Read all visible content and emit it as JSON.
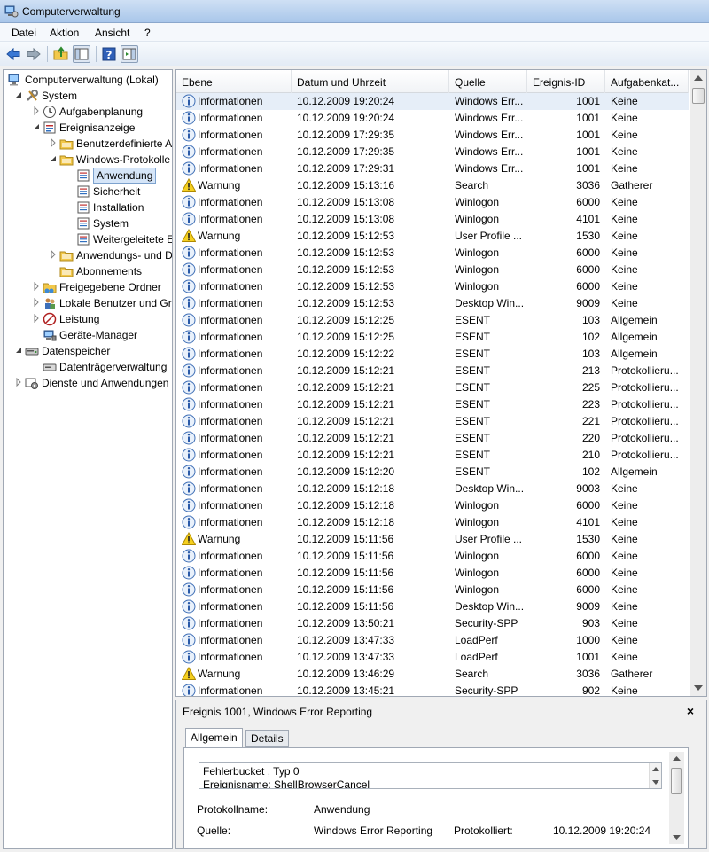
{
  "window": {
    "title": "Computerverwaltung"
  },
  "menu": [
    "Datei",
    "Aktion",
    "Ansicht",
    "?"
  ],
  "toolbar": {
    "buttons": [
      "back-arrow-icon",
      "forward-arrow-icon",
      "up-folder-icon",
      "show-hide-tree-icon",
      "help-icon",
      "action-pane-icon"
    ]
  },
  "tree": [
    {
      "label": "Computerverwaltung (Lokal)",
      "icon": "computer-icon",
      "level": 0,
      "twisty": "none"
    },
    {
      "label": "System",
      "icon": "tools-icon",
      "level": 1,
      "twisty": "expanded"
    },
    {
      "label": "Aufgabenplanung",
      "icon": "clock-icon",
      "level": 2,
      "twisty": "collapsed"
    },
    {
      "label": "Ereignisanzeige",
      "icon": "event-viewer-icon",
      "level": 2,
      "twisty": "expanded"
    },
    {
      "label": "Benutzerdefinierte Ansichten",
      "icon": "folder-icon",
      "level": 3,
      "twisty": "collapsed"
    },
    {
      "label": "Windows-Protokolle",
      "icon": "folder-icon",
      "level": 3,
      "twisty": "expanded"
    },
    {
      "label": "Anwendung",
      "icon": "log-icon",
      "level": 4,
      "twisty": "none",
      "selected": true
    },
    {
      "label": "Sicherheit",
      "icon": "log-icon",
      "level": 4,
      "twisty": "none"
    },
    {
      "label": "Installation",
      "icon": "log-icon",
      "level": 4,
      "twisty": "none"
    },
    {
      "label": "System",
      "icon": "log-icon",
      "level": 4,
      "twisty": "none"
    },
    {
      "label": "Weitergeleitete Ereignisse",
      "icon": "log-icon",
      "level": 4,
      "twisty": "none"
    },
    {
      "label": "Anwendungs- und Dienstprotokolle",
      "icon": "folder-icon",
      "level": 3,
      "twisty": "collapsed"
    },
    {
      "label": "Abonnements",
      "icon": "folder-icon",
      "level": 3,
      "twisty": "none"
    },
    {
      "label": "Freigegebene Ordner",
      "icon": "shared-folder-icon",
      "level": 2,
      "twisty": "collapsed"
    },
    {
      "label": "Lokale Benutzer und Gruppen",
      "icon": "users-icon",
      "level": 2,
      "twisty": "collapsed"
    },
    {
      "label": "Leistung",
      "icon": "performance-icon",
      "level": 2,
      "twisty": "collapsed"
    },
    {
      "label": "Geräte-Manager",
      "icon": "device-manager-icon",
      "level": 2,
      "twisty": "none"
    },
    {
      "label": "Datenspeicher",
      "icon": "storage-icon",
      "level": 1,
      "twisty": "expanded"
    },
    {
      "label": "Datenträgerverwaltung",
      "icon": "disk-icon",
      "level": 2,
      "twisty": "none"
    },
    {
      "label": "Dienste und Anwendungen",
      "icon": "services-icon",
      "level": 1,
      "twisty": "collapsed"
    }
  ],
  "events": {
    "columns": [
      "Ebene",
      "Datum und Uhrzeit",
      "Quelle",
      "Ereignis-ID",
      "Aufgabenkat..."
    ],
    "rows": [
      [
        "info",
        "Informationen",
        "10.12.2009 19:20:24",
        "Windows Err...",
        "1001",
        "Keine"
      ],
      [
        "info",
        "Informationen",
        "10.12.2009 19:20:24",
        "Windows Err...",
        "1001",
        "Keine"
      ],
      [
        "info",
        "Informationen",
        "10.12.2009 17:29:35",
        "Windows Err...",
        "1001",
        "Keine"
      ],
      [
        "info",
        "Informationen",
        "10.12.2009 17:29:35",
        "Windows Err...",
        "1001",
        "Keine"
      ],
      [
        "info",
        "Informationen",
        "10.12.2009 17:29:31",
        "Windows Err...",
        "1001",
        "Keine"
      ],
      [
        "warn",
        "Warnung",
        "10.12.2009 15:13:16",
        "Search",
        "3036",
        "Gatherer"
      ],
      [
        "info",
        "Informationen",
        "10.12.2009 15:13:08",
        "Winlogon",
        "6000",
        "Keine"
      ],
      [
        "info",
        "Informationen",
        "10.12.2009 15:13:08",
        "Winlogon",
        "4101",
        "Keine"
      ],
      [
        "warn",
        "Warnung",
        "10.12.2009 15:12:53",
        "User Profile ...",
        "1530",
        "Keine"
      ],
      [
        "info",
        "Informationen",
        "10.12.2009 15:12:53",
        "Winlogon",
        "6000",
        "Keine"
      ],
      [
        "info",
        "Informationen",
        "10.12.2009 15:12:53",
        "Winlogon",
        "6000",
        "Keine"
      ],
      [
        "info",
        "Informationen",
        "10.12.2009 15:12:53",
        "Winlogon",
        "6000",
        "Keine"
      ],
      [
        "info",
        "Informationen",
        "10.12.2009 15:12:53",
        "Desktop Win...",
        "9009",
        "Keine"
      ],
      [
        "info",
        "Informationen",
        "10.12.2009 15:12:25",
        "ESENT",
        "103",
        "Allgemein"
      ],
      [
        "info",
        "Informationen",
        "10.12.2009 15:12:25",
        "ESENT",
        "102",
        "Allgemein"
      ],
      [
        "info",
        "Informationen",
        "10.12.2009 15:12:22",
        "ESENT",
        "103",
        "Allgemein"
      ],
      [
        "info",
        "Informationen",
        "10.12.2009 15:12:21",
        "ESENT",
        "213",
        "Protokollieru..."
      ],
      [
        "info",
        "Informationen",
        "10.12.2009 15:12:21",
        "ESENT",
        "225",
        "Protokollieru..."
      ],
      [
        "info",
        "Informationen",
        "10.12.2009 15:12:21",
        "ESENT",
        "223",
        "Protokollieru..."
      ],
      [
        "info",
        "Informationen",
        "10.12.2009 15:12:21",
        "ESENT",
        "221",
        "Protokollieru..."
      ],
      [
        "info",
        "Informationen",
        "10.12.2009 15:12:21",
        "ESENT",
        "220",
        "Protokollieru..."
      ],
      [
        "info",
        "Informationen",
        "10.12.2009 15:12:21",
        "ESENT",
        "210",
        "Protokollieru..."
      ],
      [
        "info",
        "Informationen",
        "10.12.2009 15:12:20",
        "ESENT",
        "102",
        "Allgemein"
      ],
      [
        "info",
        "Informationen",
        "10.12.2009 15:12:18",
        "Desktop Win...",
        "9003",
        "Keine"
      ],
      [
        "info",
        "Informationen",
        "10.12.2009 15:12:18",
        "Winlogon",
        "6000",
        "Keine"
      ],
      [
        "info",
        "Informationen",
        "10.12.2009 15:12:18",
        "Winlogon",
        "4101",
        "Keine"
      ],
      [
        "warn",
        "Warnung",
        "10.12.2009 15:11:56",
        "User Profile ...",
        "1530",
        "Keine"
      ],
      [
        "info",
        "Informationen",
        "10.12.2009 15:11:56",
        "Winlogon",
        "6000",
        "Keine"
      ],
      [
        "info",
        "Informationen",
        "10.12.2009 15:11:56",
        "Winlogon",
        "6000",
        "Keine"
      ],
      [
        "info",
        "Informationen",
        "10.12.2009 15:11:56",
        "Winlogon",
        "6000",
        "Keine"
      ],
      [
        "info",
        "Informationen",
        "10.12.2009 15:11:56",
        "Desktop Win...",
        "9009",
        "Keine"
      ],
      [
        "info",
        "Informationen",
        "10.12.2009 13:50:21",
        "Security-SPP",
        "903",
        "Keine"
      ],
      [
        "info",
        "Informationen",
        "10.12.2009 13:47:33",
        "LoadPerf",
        "1000",
        "Keine"
      ],
      [
        "info",
        "Informationen",
        "10.12.2009 13:47:33",
        "LoadPerf",
        "1001",
        "Keine"
      ],
      [
        "warn",
        "Warnung",
        "10.12.2009 13:46:29",
        "Search",
        "3036",
        "Gatherer"
      ],
      [
        "info",
        "Informationen",
        "10.12.2009 13:45:21",
        "Security-SPP",
        "902",
        "Keine"
      ]
    ]
  },
  "detail": {
    "title": "Ereignis 1001, Windows Error Reporting",
    "close": "×",
    "tabs": [
      "Allgemein",
      "Details"
    ],
    "description_lines": [
      "Fehlerbucket , Typ 0",
      "Ereignisname: ShellBrowserCancel"
    ],
    "protokollname_label": "Protokollname:",
    "protokollname_value": "Anwendung",
    "quelle_label": "Quelle:",
    "quelle_value": "Windows Error Reporting",
    "protokolliert_label": "Protokolliert:",
    "protokolliert_value": "10.12.2009 19:20:24"
  }
}
